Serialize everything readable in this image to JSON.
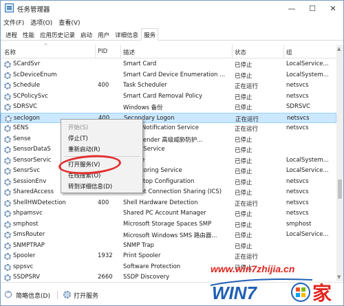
{
  "window": {
    "title": "任务管理器",
    "controls": {
      "minimize": "—",
      "maximize": "☐",
      "close": "✕"
    }
  },
  "menubar": {
    "items": [
      {
        "label": "文件(F)"
      },
      {
        "label": "选项(O)"
      },
      {
        "label": "查看(V)"
      }
    ]
  },
  "tabs": [
    {
      "label": "进程",
      "active": false
    },
    {
      "label": "性能",
      "active": false
    },
    {
      "label": "应用历史记录",
      "active": false
    },
    {
      "label": "启动",
      "active": false
    },
    {
      "label": "用户",
      "active": false
    },
    {
      "label": "详细信息",
      "active": false
    },
    {
      "label": "服务",
      "active": true
    }
  ],
  "table": {
    "columns": {
      "name": "名称",
      "pid": "PID",
      "desc": "描述",
      "status": "状态",
      "group": "组"
    },
    "sort_arrow": "^",
    "rows": [
      {
        "name": "SCardSvr",
        "pid": "",
        "desc": "Smart Card",
        "status": "已停止",
        "group": "LocalService..."
      },
      {
        "name": "ScDeviceEnum",
        "pid": "",
        "desc": "Smart Card Device Enumeration ...",
        "status": "已停止",
        "group": "LocalSystem..."
      },
      {
        "name": "Schedule",
        "pid": "400",
        "desc": "Task Scheduler",
        "status": "正在运行",
        "group": "netsvcs"
      },
      {
        "name": "SCPolicySvc",
        "pid": "",
        "desc": "Smart Card Removal Policy",
        "status": "已停止",
        "group": "netsvcs"
      },
      {
        "name": "SDRSVC",
        "pid": "",
        "desc": "Windows 备份",
        "status": "已停止",
        "group": "SDRSVC"
      },
      {
        "name": "seclogon",
        "pid": "400",
        "desc": "Secondary Logon",
        "status": "正在运行",
        "group": "netsvcs",
        "selected": true
      },
      {
        "name": "SENS",
        "pid": "",
        "desc": "Event Notification Service",
        "status": "正在运行",
        "group": "netsvcs"
      },
      {
        "name": "Sense",
        "pid": "",
        "desc": "ws Defender 高级威胁防护...",
        "status": "已停止",
        "group": ""
      },
      {
        "name": "SensorDataS",
        "pid": "",
        "desc": "r Data Service",
        "status": "已停止",
        "group": ""
      },
      {
        "name": "SensorServic",
        "pid": "",
        "desc": "Service",
        "status": "已停止",
        "group": "LocalSystem..."
      },
      {
        "name": "SensrSvc",
        "pid": "",
        "desc": "r Monitoring Service",
        "status": "已停止",
        "group": "LocalService..."
      },
      {
        "name": "SessionEnv",
        "pid": "",
        "desc": "e Desktop Configuration",
        "status": "已停止",
        "group": "netsvcs"
      },
      {
        "name": "SharedAccess",
        "pid": "",
        "desc": "Internet Connection Sharing (ICS)",
        "status": "已停止",
        "group": "netsvcs"
      },
      {
        "name": "ShellHWDetection",
        "pid": "400",
        "desc": "Shell Hardware Detection",
        "status": "正在运行",
        "group": "netsvcs"
      },
      {
        "name": "shpamsvc",
        "pid": "",
        "desc": "Shared PC Account Manager",
        "status": "已停止",
        "group": "netsvcs"
      },
      {
        "name": "smphost",
        "pid": "",
        "desc": "Microsoft Storage Spaces SMP",
        "status": "已停止",
        "group": "smphost"
      },
      {
        "name": "SmsRouter",
        "pid": "",
        "desc": "Microsoft Windows SMS 路由器...",
        "status": "已停止",
        "group": "LocalService..."
      },
      {
        "name": "SNMPTRAP",
        "pid": "",
        "desc": "SNMP Trap",
        "status": "已停止",
        "group": ""
      },
      {
        "name": "Spooler",
        "pid": "1932",
        "desc": "Print Spooler",
        "status": "正在运行",
        "group": ""
      },
      {
        "name": "sppsvc",
        "pid": "",
        "desc": "Software Protection",
        "status": "已停止",
        "group": ""
      },
      {
        "name": "SSDPSRV",
        "pid": "2660",
        "desc": "SSDP Discovery",
        "status": "",
        "group": ""
      }
    ]
  },
  "context_menu": {
    "items": [
      {
        "label": "开始(S)",
        "disabled": true
      },
      {
        "label": "停止(T)",
        "disabled": false
      },
      {
        "label": "重新启动(R)",
        "disabled": false
      },
      {
        "label": "打开服务(V)",
        "disabled": false
      },
      {
        "label": "在线搜索(O)",
        "disabled": false
      },
      {
        "label": "转到详细信息(D)",
        "disabled": false
      }
    ]
  },
  "statusbar": {
    "collapse_label": "简略信息(D)",
    "open_services_label": "打开服务"
  },
  "watermark": {
    "url": "www.win7zhijia.cn",
    "logo_text_a": "WIN7",
    "logo_text_b": "家"
  },
  "colors": {
    "accent": "#0078d7",
    "selected_row": "#cce8ff",
    "highlight_oval": "#e32e2e",
    "watermark_red": "#e0261f",
    "watermark_blue": "#1e5fb4"
  },
  "icons": {
    "service": "gear-icon",
    "app": "task-manager-icon",
    "collapse": "chevron-up-icon",
    "open_services": "services-gear-icon"
  }
}
